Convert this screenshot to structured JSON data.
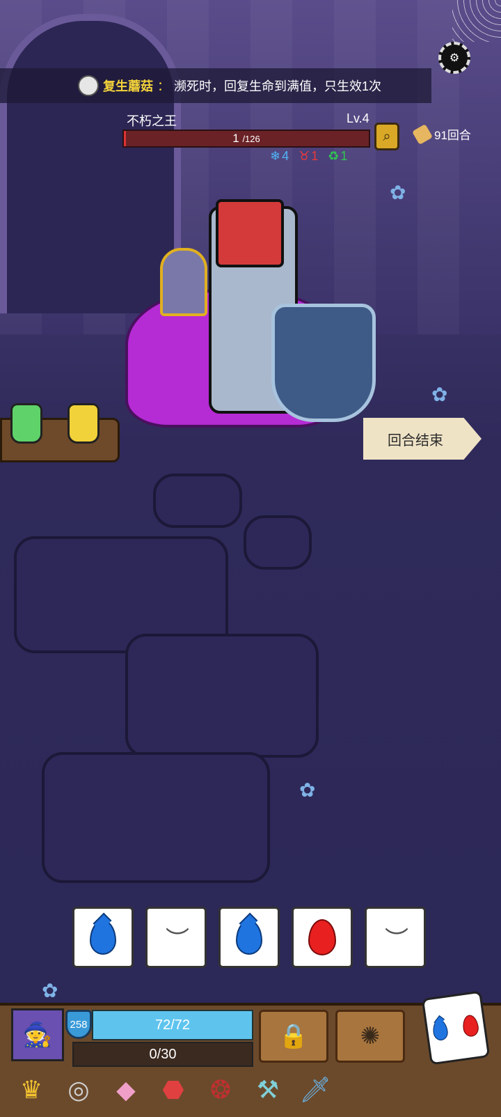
{
  "buff": {
    "name": "复生蘑菇",
    "separator": "：",
    "description": "濒死时，回复生命到满值，只生效1次"
  },
  "enemy": {
    "name": "不朽之王",
    "level": "Lv.4",
    "hp_current": "1",
    "hp_max": "/126",
    "hp_fraction": 0.008,
    "intents": [
      {
        "icon": "snowflake-icon",
        "glyph": "❄",
        "value": "4",
        "color": "#4fb3f5"
      },
      {
        "icon": "demon-icon",
        "glyph": "♉",
        "value": "1",
        "color": "#e83a3a"
      },
      {
        "icon": "regen-icon",
        "glyph": "♻",
        "value": "1",
        "color": "#2ec850"
      }
    ]
  },
  "rounds": {
    "label": "91回合"
  },
  "end_turn": {
    "label": "回合结束"
  },
  "dice": [
    {
      "face": "water"
    },
    {
      "face": "eye"
    },
    {
      "face": "water"
    },
    {
      "face": "fire"
    },
    {
      "face": "eye"
    }
  ],
  "player": {
    "armor": "258",
    "hp": "72/72",
    "xp": "0/30",
    "hp_fraction": 1.0
  },
  "skills": [
    {
      "icon": "locked-weapon-icon",
      "glyph": "🔒"
    },
    {
      "icon": "explosion-skill-icon",
      "glyph": "✺"
    }
  ],
  "relics": [
    {
      "icon": "crown-icon",
      "glyph": "♛",
      "color": "#f2c230"
    },
    {
      "icon": "ring-icon",
      "glyph": "◎",
      "color": "#d0d0d0"
    },
    {
      "icon": "crystal-die-icon",
      "glyph": "◆",
      "color": "#f0a0c8"
    },
    {
      "icon": "rune-stone-icon",
      "glyph": "⬣",
      "color": "#e04040"
    },
    {
      "icon": "spiked-ring-icon",
      "glyph": "❂",
      "color": "#c03030"
    },
    {
      "icon": "scythe-icon",
      "glyph": "⚒",
      "color": "#7fd0d8"
    },
    {
      "icon": "dagger-icon",
      "glyph": "🗡",
      "color": "#6ab0e0"
    }
  ],
  "colors": {
    "buff_name": "#f3d23a",
    "hp_bar": "#d33333",
    "player_hp": "#5ec4ee",
    "panel": "#6b4a2c"
  }
}
